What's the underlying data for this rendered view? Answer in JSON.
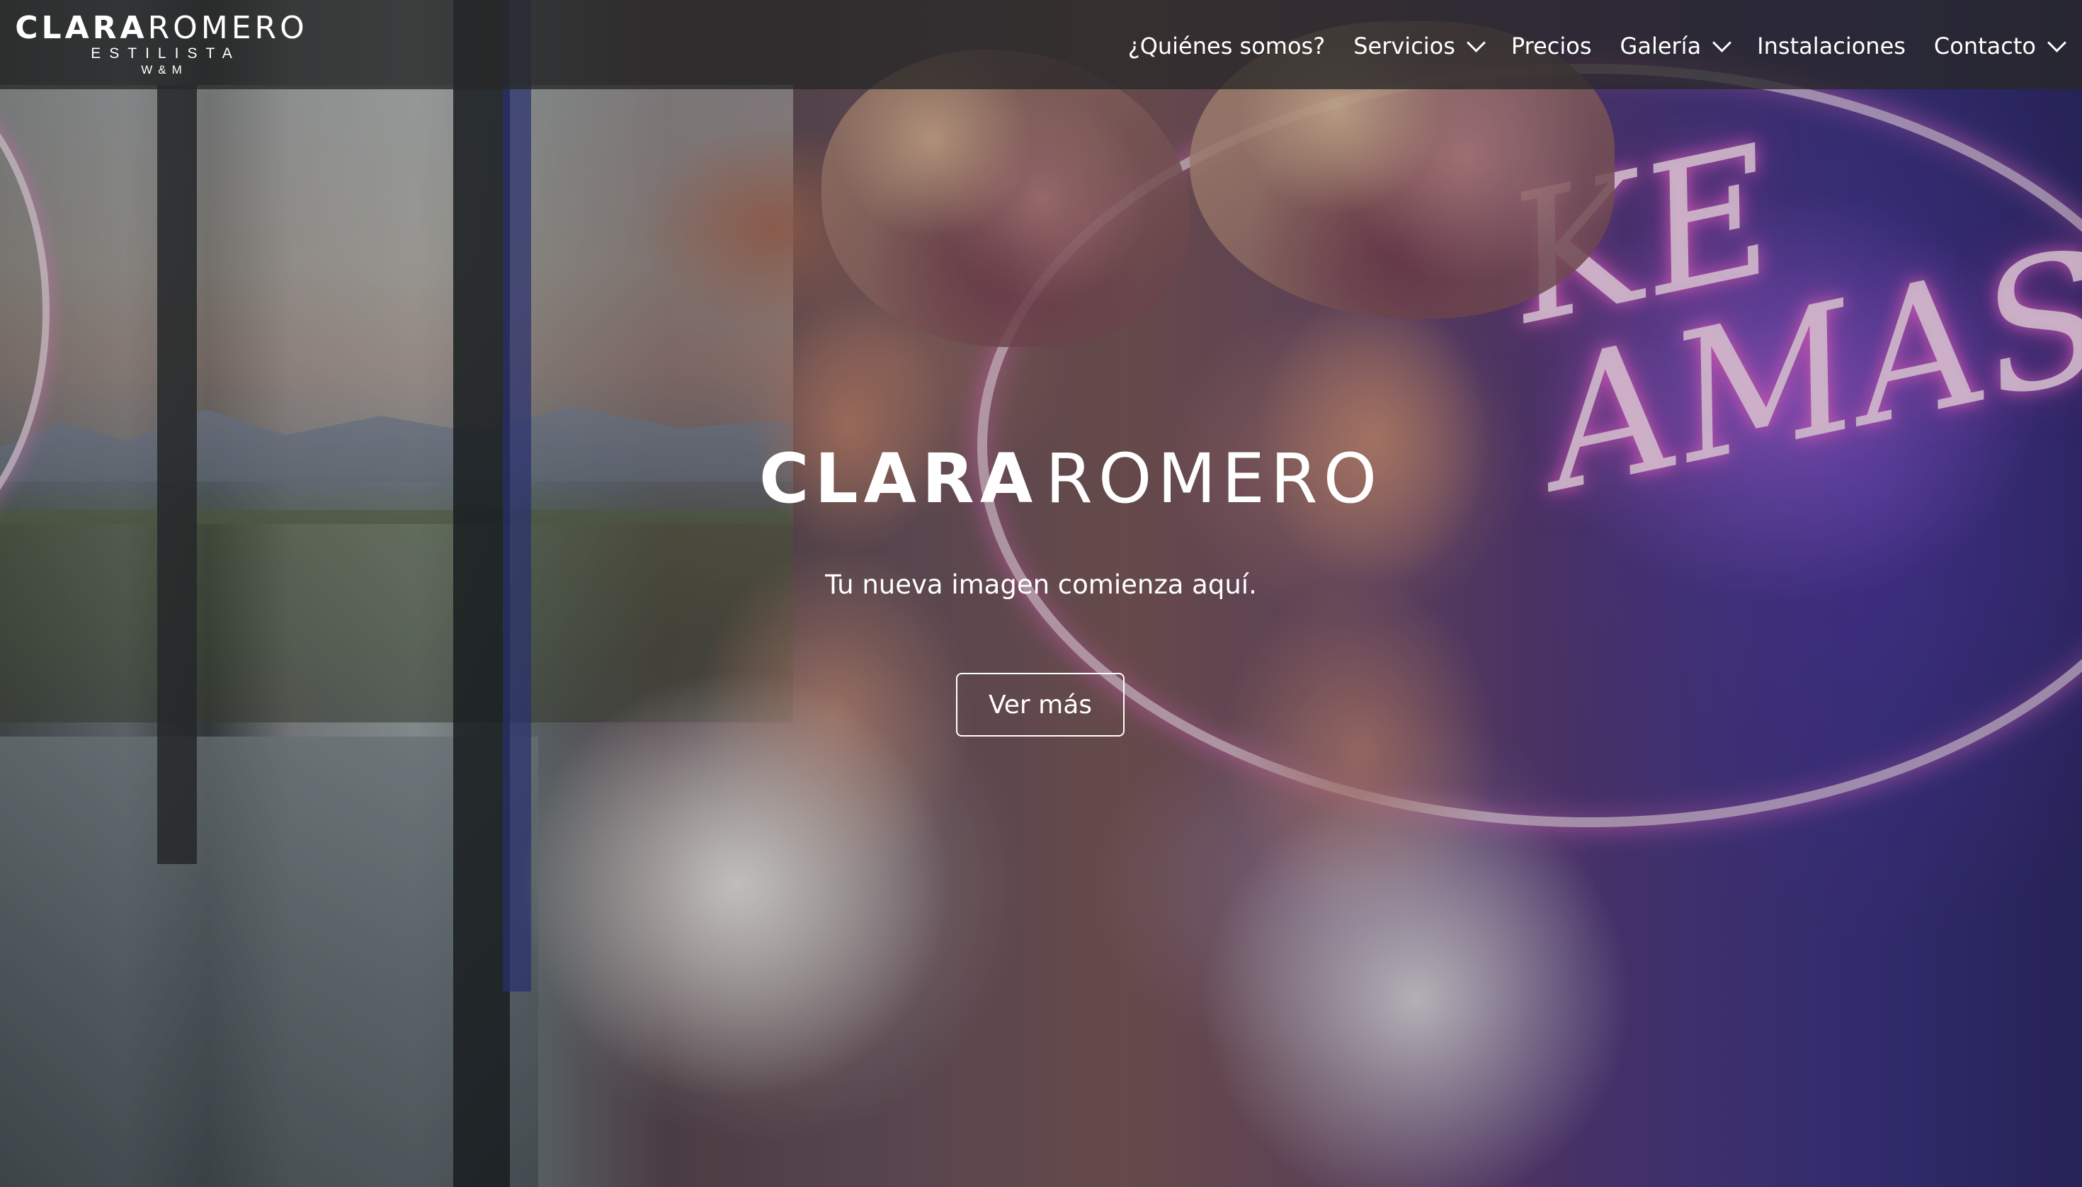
{
  "brand": {
    "name_part1": "CLARA",
    "name_part2": "ROMERO",
    "subtitle": "ESTILISTA",
    "initials": "W&M"
  },
  "nav": {
    "items": [
      {
        "label": "¿Quiénes somos?",
        "has_dropdown": false
      },
      {
        "label": "Servicios",
        "has_dropdown": true
      },
      {
        "label": "Precios",
        "has_dropdown": false
      },
      {
        "label": "Galería",
        "has_dropdown": true
      },
      {
        "label": "Instalaciones",
        "has_dropdown": false
      },
      {
        "label": "Contacto",
        "has_dropdown": true
      }
    ]
  },
  "hero": {
    "logo_part1": "CLARA",
    "logo_part2": "ROMERO",
    "tagline": "Tu nueva imagen comienza aquí.",
    "cta_label": "Ver más",
    "neon_text": "KE AMAS"
  },
  "colors": {
    "navbar_bg": "#282828",
    "text": "#ffffff",
    "neon_pink": "#ff6edc",
    "neon_purple": "#4a3a86"
  }
}
